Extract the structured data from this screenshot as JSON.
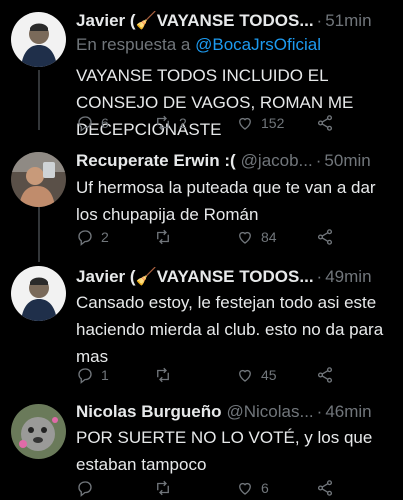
{
  "tweets": [
    {
      "name": "Javier (🧹VAYANSE TODOS...",
      "handle": "",
      "time": "51min",
      "reply_prefix": "En respuesta a",
      "reply_mention": "@BocaJrsOficial",
      "text": "VAYANSE TODOS INCLUIDO EL CONSEJO DE VAGOS, ROMAN ME DECEPCIONASTE",
      "replies": "6",
      "retweets": "2",
      "likes": "152"
    },
    {
      "name": "Recuperate Erwin :(",
      "handle": "@jacob...",
      "time": "50min",
      "text": "Uf hermosa la puteada que te van a dar los chupapija de Román",
      "replies": "2",
      "retweets": "",
      "likes": "84"
    },
    {
      "name": "Javier (🧹VAYANSE TODOS...",
      "handle": "",
      "time": "49min",
      "text": "Cansado estoy, le festejan todo asi este haciendo mierda al club. esto no da para mas",
      "replies": "1",
      "retweets": "",
      "likes": "45"
    },
    {
      "name": "Nicolas Burgueño",
      "handle": "@Nicolas...",
      "time": "46min",
      "text": "POR SUERTE NO LO VOTÉ, y los que estaban tampoco",
      "replies": "",
      "retweets": "",
      "likes": "6"
    }
  ],
  "separator": "·",
  "icons": [
    "reply-icon",
    "retweet-icon",
    "like-icon",
    "share-icon"
  ],
  "colors": {
    "background": "#000000",
    "text": "#e7e9ea",
    "secondary": "#71767b",
    "link": "#1d9bf0"
  }
}
